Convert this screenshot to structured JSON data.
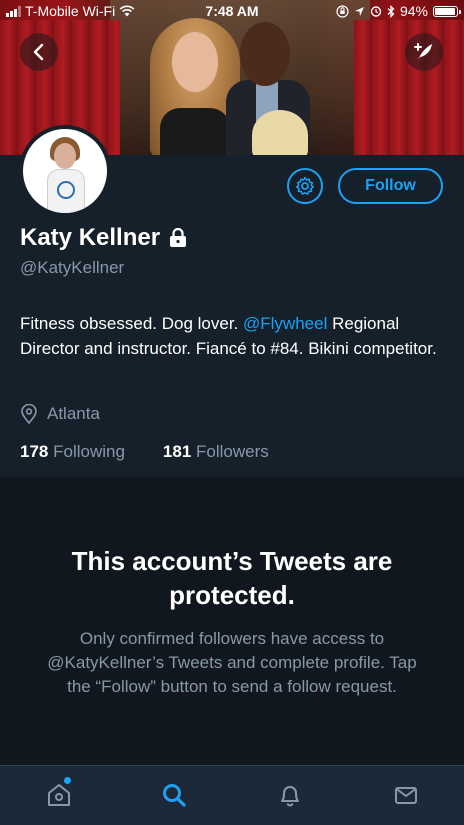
{
  "status_bar": {
    "carrier": "T-Mobile Wi-Fi",
    "time": "7:48 AM",
    "battery": "94%"
  },
  "profile": {
    "name": "Katy Kellner",
    "handle": "@KatyKellner",
    "follow_label": "Follow",
    "bio": {
      "part1": "Fitness obsessed. Dog lover. ",
      "mention": "@Flywheel",
      "part2": " Regional Director and instructor. Fiancé to #84. Bikini competitor."
    },
    "location": "Atlanta",
    "following_count": "178",
    "following_label": "Following",
    "followers_count": "181",
    "followers_label": "Followers"
  },
  "protected_notice": {
    "title": "This account’s Tweets are protected.",
    "body": "Only confirmed followers have access to @KatyKellner’s Tweets and complete profile. Tap the “Follow” button to send a follow request."
  },
  "icons": {
    "back": "chevron-left-icon",
    "compose": "compose-tweet-icon",
    "settings": "gear-icon",
    "lock": "lock-icon",
    "location": "location-pin-icon",
    "home": "home-icon",
    "search": "search-icon",
    "notifications": "bell-icon",
    "messages": "mail-icon"
  },
  "colors": {
    "background": "#15202b",
    "accent": "#1da1f2",
    "secondary_text": "#8899a6",
    "tabbar": "#1c2938"
  }
}
